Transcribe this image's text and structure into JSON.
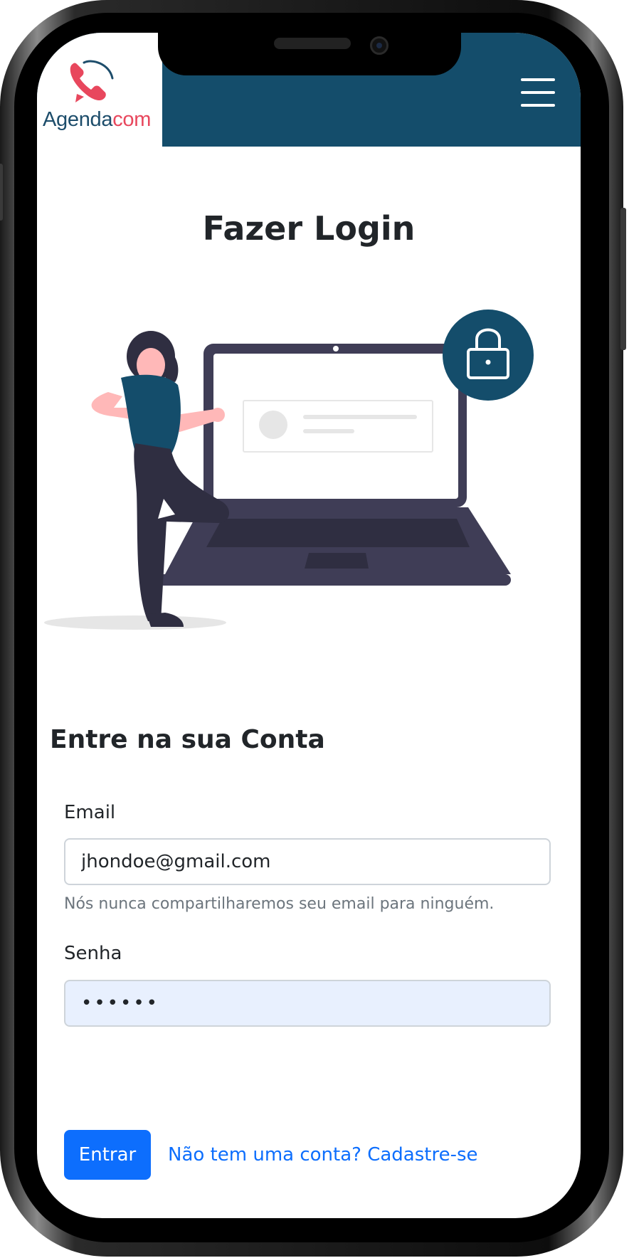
{
  "brand": {
    "name_part1": "Agenda",
    "name_part2": "com",
    "primary_color": "#144d6b",
    "accent_color": "#e8475d"
  },
  "navbar": {
    "menu_icon": "hamburger-menu-icon"
  },
  "page": {
    "title": "Fazer Login"
  },
  "hero": {
    "illustration": "woman-with-laptop-and-lock-illustration",
    "lock_icon": "padlock-icon"
  },
  "form": {
    "heading": "Entre na sua Conta",
    "email": {
      "label": "Email",
      "value": "jhondoe@gmail.com",
      "help": "Nós nunca compartilharemos seu email para ninguém."
    },
    "password": {
      "label": "Senha",
      "value": "••••••"
    },
    "submit_label": "Entrar",
    "signup_link": "Não tem uma conta? Cadastre-se"
  }
}
